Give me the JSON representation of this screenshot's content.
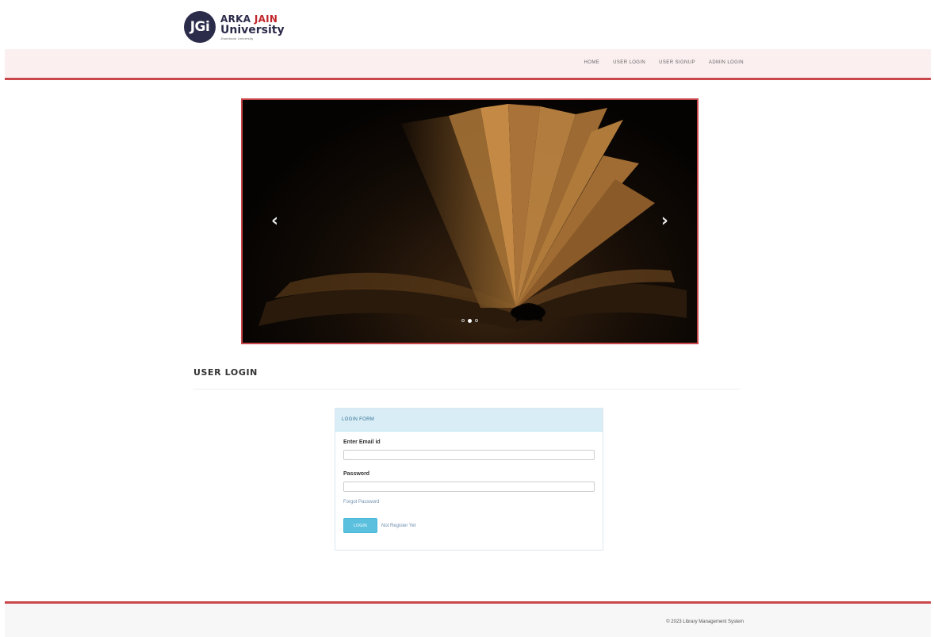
{
  "brand": {
    "logo_initials": "JGi",
    "name_part1": "ARKA",
    "name_part2": "JAIN",
    "name_line2": "University",
    "tagline": "Jharkhand University"
  },
  "nav": {
    "items": [
      {
        "label": "HOME"
      },
      {
        "label": "USER LOGIN"
      },
      {
        "label": "USER SIGNUP"
      },
      {
        "label": "ADMIN LOGIN"
      }
    ]
  },
  "carousel": {
    "prev_icon": "chevron-left-icon",
    "next_icon": "chevron-right-icon",
    "prev_glyph": "‹",
    "next_glyph": "›",
    "slide_count": 3,
    "active_slide": 2
  },
  "section": {
    "title": "USER LOGIN"
  },
  "login_form": {
    "heading": "LOGIN FORM",
    "email_label": "Enter Email id",
    "email_value": "",
    "password_label": "Password",
    "password_value": "",
    "forgot_link": "Forgot Password",
    "login_button": "LOGIN",
    "register_link": "Not Register Yet"
  },
  "footer": {
    "text": "© 2023 Library Management System"
  },
  "colors": {
    "accent_red": "#c9474b",
    "nav_background": "#fbeff0",
    "panel_heading": "#d9edf7",
    "button": "#5bc0de"
  }
}
